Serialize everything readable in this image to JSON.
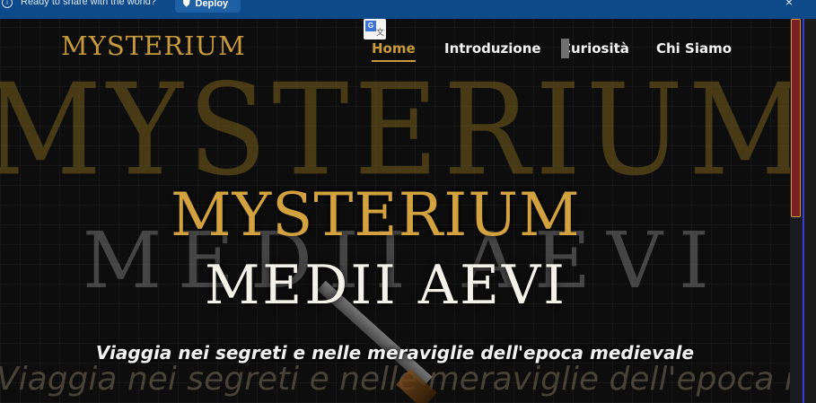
{
  "topbar": {
    "info_icon": "info-icon",
    "message": "Ready to share with the world?",
    "deploy_label": "Deploy",
    "deploy_icon": "deploy-icon",
    "close_label": "×"
  },
  "site": {
    "logo": "MYSTERIUM",
    "nav": [
      {
        "label": "Home",
        "active": true
      },
      {
        "label": "Introduzione",
        "active": false
      },
      {
        "label": "Curiosità",
        "active": false
      },
      {
        "label": "Chi Siamo",
        "active": false
      }
    ],
    "background_title_1": "MYSTERIUM",
    "background_title_2": "MEDII AEVI",
    "background_subtitle": "Viaggia nei segreti e nelle meraviglie dell'epoca medievale",
    "hero_title_1": "MYSTERIUM",
    "hero_title_2": "MEDII AEVI",
    "hero_subtitle": "Viaggia nei segreti e nelle meraviglie dell'epoca medievale"
  },
  "colors": {
    "accent_gold": "#c99a3c",
    "topbar_blue": "#0e4a8a",
    "scroll_thumb": "#7a2020"
  }
}
